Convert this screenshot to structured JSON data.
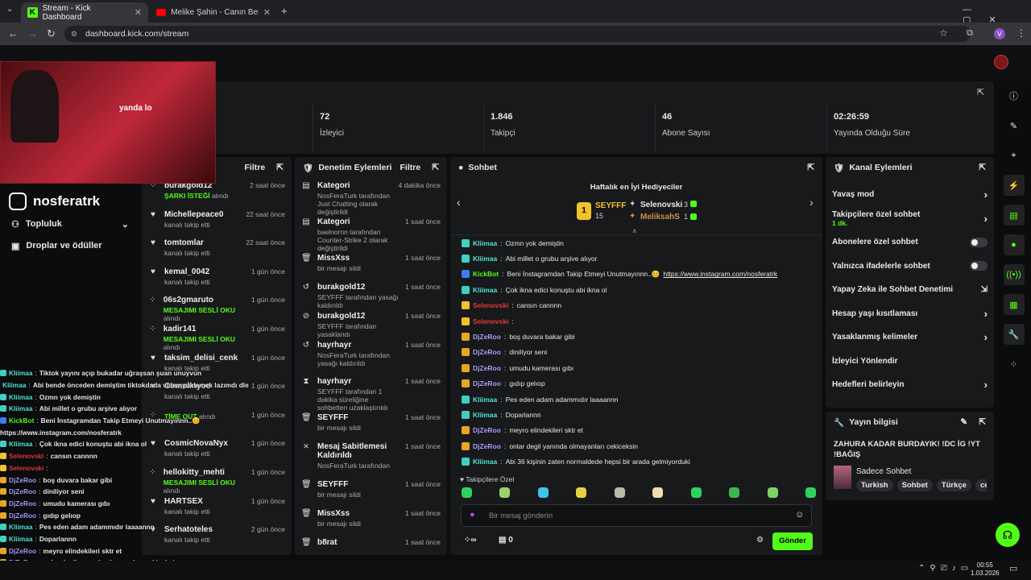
{
  "browser": {
    "tabs": [
      {
        "title": "Stream - Kick Dashboard"
      },
      {
        "title": "Melike Şahin - Canın Beni Çekti"
      }
    ],
    "url": "dashboard.kick.com/stream",
    "profile_letter": "V"
  },
  "stats": [
    {
      "value": "72",
      "label": "İzleyici"
    },
    {
      "value": "1.846",
      "label": "Takipçi"
    },
    {
      "value": "46",
      "label": "Abone Sayısı"
    },
    {
      "value": "02:26:59",
      "label": "Yayında Olduğu Süre"
    }
  ],
  "overlay": {
    "handle": "nosferatrk",
    "menu": [
      "Topluluk",
      "Droplar ve ödüller"
    ],
    "webcam_text": "yanda lo"
  },
  "activity": {
    "filter": "Filtre",
    "items": [
      {
        "name": "burakgold12",
        "sub": "ŞARKI İSTEĞİ",
        "sub2": " alındı",
        "time": "2 saat önce",
        "icon": "gift-icon"
      },
      {
        "name": "Michellepeace0",
        "sub": "kanalı takip etti",
        "time": "22 saat önce",
        "icon": "heart-icon"
      },
      {
        "name": "tomtomlar",
        "sub": "kanalı takip etti",
        "time": "22 saat önce",
        "icon": "heart-icon"
      },
      {
        "name": "kemal_0042",
        "sub": "kanalı takip etti",
        "time": "1 gün önce",
        "icon": "heart-icon"
      },
      {
        "name": "06s2gmaruto",
        "sub": "MESAJIMI SESLİ OKU",
        "sub2": " alındı",
        "time": "1 gün önce",
        "icon": "gift-icon"
      },
      {
        "name": "kadir141",
        "sub": "MESAJIMI SESLİ OKU",
        "sub2": " alındı",
        "time": "1 gün önce",
        "icon": "gift-icon"
      },
      {
        "name": "taksim_delisi_cenk",
        "sub": "kanalı takip etti",
        "time": "1 gün önce",
        "icon": "heart-icon"
      },
      {
        "name": "Comolinyoo",
        "sub": "kanalı takip etti",
        "time": "1 gün önce",
        "icon": "heart-icon"
      },
      {
        "name": "",
        "sub": "TİME OUT",
        "sub2": " alındı",
        "time": "1 gün önce",
        "icon": "gift-icon"
      },
      {
        "name": "CosmicNovaNyx",
        "sub": "kanalı takip etti",
        "time": "1 gün önce",
        "icon": "heart-icon"
      },
      {
        "name": "hellokitty_mehti",
        "sub": "MESAJIMI SESLİ OKU",
        "sub2": " alındı",
        "time": "1 gün önce",
        "icon": "gift-icon"
      },
      {
        "name": "HARTSEX",
        "sub": "kanalı takip etti",
        "time": "1 gün önce",
        "icon": "heart-icon"
      },
      {
        "name": "Serhatoteles",
        "sub": "kanalı takip etti",
        "time": "2 gün önce",
        "icon": "heart-icon"
      }
    ]
  },
  "moderation": {
    "title": "Denetim Eylemleri",
    "filter": "Filtre",
    "items": [
      {
        "title": "Kategori",
        "line": "NosFeraTurk tarafından Just Chatting olarak değiştirildi",
        "time": "4 dakika önce",
        "icon": "category-icon"
      },
      {
        "title": "Kategori",
        "line": "baelnornn tarafından Counter-Strike 2 olarak değiştirildi",
        "time": "1 saat önce",
        "icon": "category-icon"
      },
      {
        "title": "MissXss",
        "line": "bir mesajı sildi",
        "time": "1 saat önce",
        "icon": "trash-icon"
      },
      {
        "title": "burakgold12",
        "line": "SEYFFF tarafından yasağı kaldırıldı",
        "time": "1 saat önce",
        "icon": "unban-icon"
      },
      {
        "title": "burakgold12",
        "line": "SEYFFF tarafından yasaklandı",
        "time": "1 saat önce",
        "icon": "ban-icon"
      },
      {
        "title": "hayrhayr",
        "line": "NosFeraTurk tarafından yasağı kaldırıldı",
        "time": "1 saat önce",
        "icon": "unban-icon"
      },
      {
        "title": "hayrhayr",
        "line": "SEYFFF tarafından 1 dakika süreliğine sohbetten uzaklaştırıldı",
        "time": "1 saat önce",
        "icon": "hourglass-icon"
      },
      {
        "title": "SEYFFF",
        "line": "bir mesajı sildi",
        "time": "1 saat önce",
        "icon": "trash-icon"
      },
      {
        "title": "Mesaj Sabitlemesi Kaldırıldı",
        "line": "NosFeraTurk tarafından",
        "time": "1 saat önce",
        "icon": "unpin-icon"
      },
      {
        "title": "SEYFFF",
        "line": "bir mesajı sildi",
        "time": "1 saat önce",
        "icon": "trash-icon"
      },
      {
        "title": "MissXss",
        "line": "bir mesajı sildi",
        "time": "1 saat önce",
        "icon": "trash-icon"
      },
      {
        "title": "b8rat",
        "line": "",
        "time": "1 saat önce",
        "icon": "trash-icon"
      }
    ]
  },
  "chat": {
    "title": "Sohbet",
    "gifters_title": "Haftalık en İyi Hediyeciler",
    "top": {
      "name": "SEYFFF",
      "amount": "15",
      "rank": "1"
    },
    "second": {
      "name": "Selenovski",
      "amount": "3"
    },
    "third": {
      "name": "MeliksahS",
      "amount": "1"
    },
    "messages": [
      {
        "user": "Kliimaa",
        "cls": "ucyan",
        "text": "Ozmn yok demiştin"
      },
      {
        "user": "Kliimaa",
        "cls": "ucyan",
        "text": "Abi millet o grubu arşive alıyor"
      },
      {
        "user": "KickBot",
        "cls": "ugreen",
        "text": "Beni İnstagramdan Takip Etmeyi Unutmayınnn..😊 ",
        "link": "https://www.instagram.com/nosferatrk"
      },
      {
        "user": "Kliimaa",
        "cls": "ucyan",
        "text": "Çok ikna edici konuştu abi ikna ol"
      },
      {
        "user": "Selenovski",
        "cls": "ured",
        "text": "cansın cannnn"
      },
      {
        "user": "Selenovski",
        "cls": "ured",
        "text": ""
      },
      {
        "user": "DjZeRoo",
        "cls": "upurple",
        "text": "boş duvara bakar gibi"
      },
      {
        "user": "DjZeRoo",
        "cls": "upurple",
        "text": "diniliyor seni"
      },
      {
        "user": "DjZeRoo",
        "cls": "upurple",
        "text": "umudu kamerası gıbı"
      },
      {
        "user": "DjZeRoo",
        "cls": "upurple",
        "text": "gıdıp gelıop"
      },
      {
        "user": "Kliimaa",
        "cls": "ucyan",
        "text": "Pes eden adam adammıdır laaaannn"
      },
      {
        "user": "Kliimaa",
        "cls": "ucyan",
        "text": "Doparlannn"
      },
      {
        "user": "DjZeRoo",
        "cls": "upurple",
        "text": "meyro elindekileri sktr et"
      },
      {
        "user": "DjZeRoo",
        "cls": "upurple",
        "text": "onlar degil yanında olmayanları cekiceksin"
      },
      {
        "user": "Kliimaa",
        "cls": "ucyan",
        "text": "Abi 36 kişinin zaten normaldede hepsi bir arada gelmiyorduki"
      }
    ],
    "emote_label": "Takipçilere Özel",
    "placeholder": "Bir mesaj gönderin",
    "send": "Gönder",
    "count": "0"
  },
  "channel_actions": {
    "title": "Kanal Eylemleri",
    "items": [
      {
        "label": "Yavaş mod",
        "kind": "chev"
      },
      {
        "label": "Takipçilere özel sohbet",
        "sub": "1 dk.",
        "kind": "chev"
      },
      {
        "label": "Abonelere özel sohbet",
        "kind": "toggle"
      },
      {
        "label": "Yalnızca ifadelerle sohbet",
        "kind": "toggle"
      },
      {
        "label": "Yapay Zeka ile Sohbet Denetimi",
        "kind": "ext"
      },
      {
        "label": "Hesap yaşı kısıtlaması",
        "kind": "chev"
      },
      {
        "label": "Yasaklanmış kelimeler",
        "kind": "chev"
      },
      {
        "label": "İzleyici Yönlendir",
        "kind": "none"
      },
      {
        "label": "Hedefleri belirleyin",
        "kind": "chev"
      }
    ]
  },
  "stream_info": {
    "title": "Yayın bilgisi",
    "stream_title": "ZAHURA KADAR BURDAYIK! !DC İG !YT !BAĞIŞ",
    "category": "Sadece Sohbet",
    "tags": [
      "Turkish",
      "Sohbet",
      "Türkçe",
      "cek"
    ]
  },
  "overlay_chat": [
    {
      "user": "Kliimaa",
      "cls": "ucyan",
      "text": "Tiktok yayını açıp bukadar uğraşsan şuan unuyvun"
    },
    {
      "user": "Kliimaa",
      "cls": "ucyan",
      "text": "Abi bende önceden demiştim tiktokdada video yuklemek lazımdı dle"
    },
    {
      "user": "Kliimaa",
      "cls": "ucyan",
      "text": "Ozmn yok demiştin"
    },
    {
      "user": "Kliimaa",
      "cls": "ucyan",
      "text": "Abi millet o grubu arşive alıyor"
    },
    {
      "user": "KickBot",
      "cls": "ugreen",
      "text": "Beni İnstagramdan Takip Etmeyi Unutmayınnn..😊"
    },
    {
      "user": "",
      "cls": "",
      "text": "https://www.instagram.com/nosferatrk"
    },
    {
      "user": "Kliimaa",
      "cls": "ucyan",
      "text": "Çok ikna edici konuştu abi ikna ol"
    },
    {
      "user": "Selenovski",
      "cls": "ured",
      "text": "cansın cannnn"
    },
    {
      "user": "Selenovski",
      "cls": "ured",
      "text": ""
    },
    {
      "user": "DjZeRoo",
      "cls": "upurple",
      "text": "boş duvara bakar gibi"
    },
    {
      "user": "DjZeRoo",
      "cls": "upurple",
      "text": "diniliyor seni"
    },
    {
      "user": "DjZeRoo",
      "cls": "upurple",
      "text": "umudu kamerası gıbı"
    },
    {
      "user": "DjZeRoo",
      "cls": "upurple",
      "text": "gıdıp gelıop"
    },
    {
      "user": "Kliimaa",
      "cls": "ucyan",
      "text": "Pes eden adam adammıdır laaaannn"
    },
    {
      "user": "Kliimaa",
      "cls": "ucyan",
      "text": "Doparlannn"
    },
    {
      "user": "DjZeRoo",
      "cls": "upurple",
      "text": "meyro elindekileri sktr et"
    },
    {
      "user": "DjZeRoo",
      "cls": "upurple",
      "text": "onlar degil yanında olmayanları cekiceksin"
    },
    {
      "user": "Kliimaa",
      "cls": "ucyan",
      "text": "Abi 36 kişinin zaten normaldede hepsi bir arada gelmiyorduki"
    }
  ],
  "taskbar": {
    "time": "00:55",
    "date": "1.03.2026"
  },
  "colors": {
    "kick_green": "#53fc18",
    "panel": "#18191b"
  }
}
